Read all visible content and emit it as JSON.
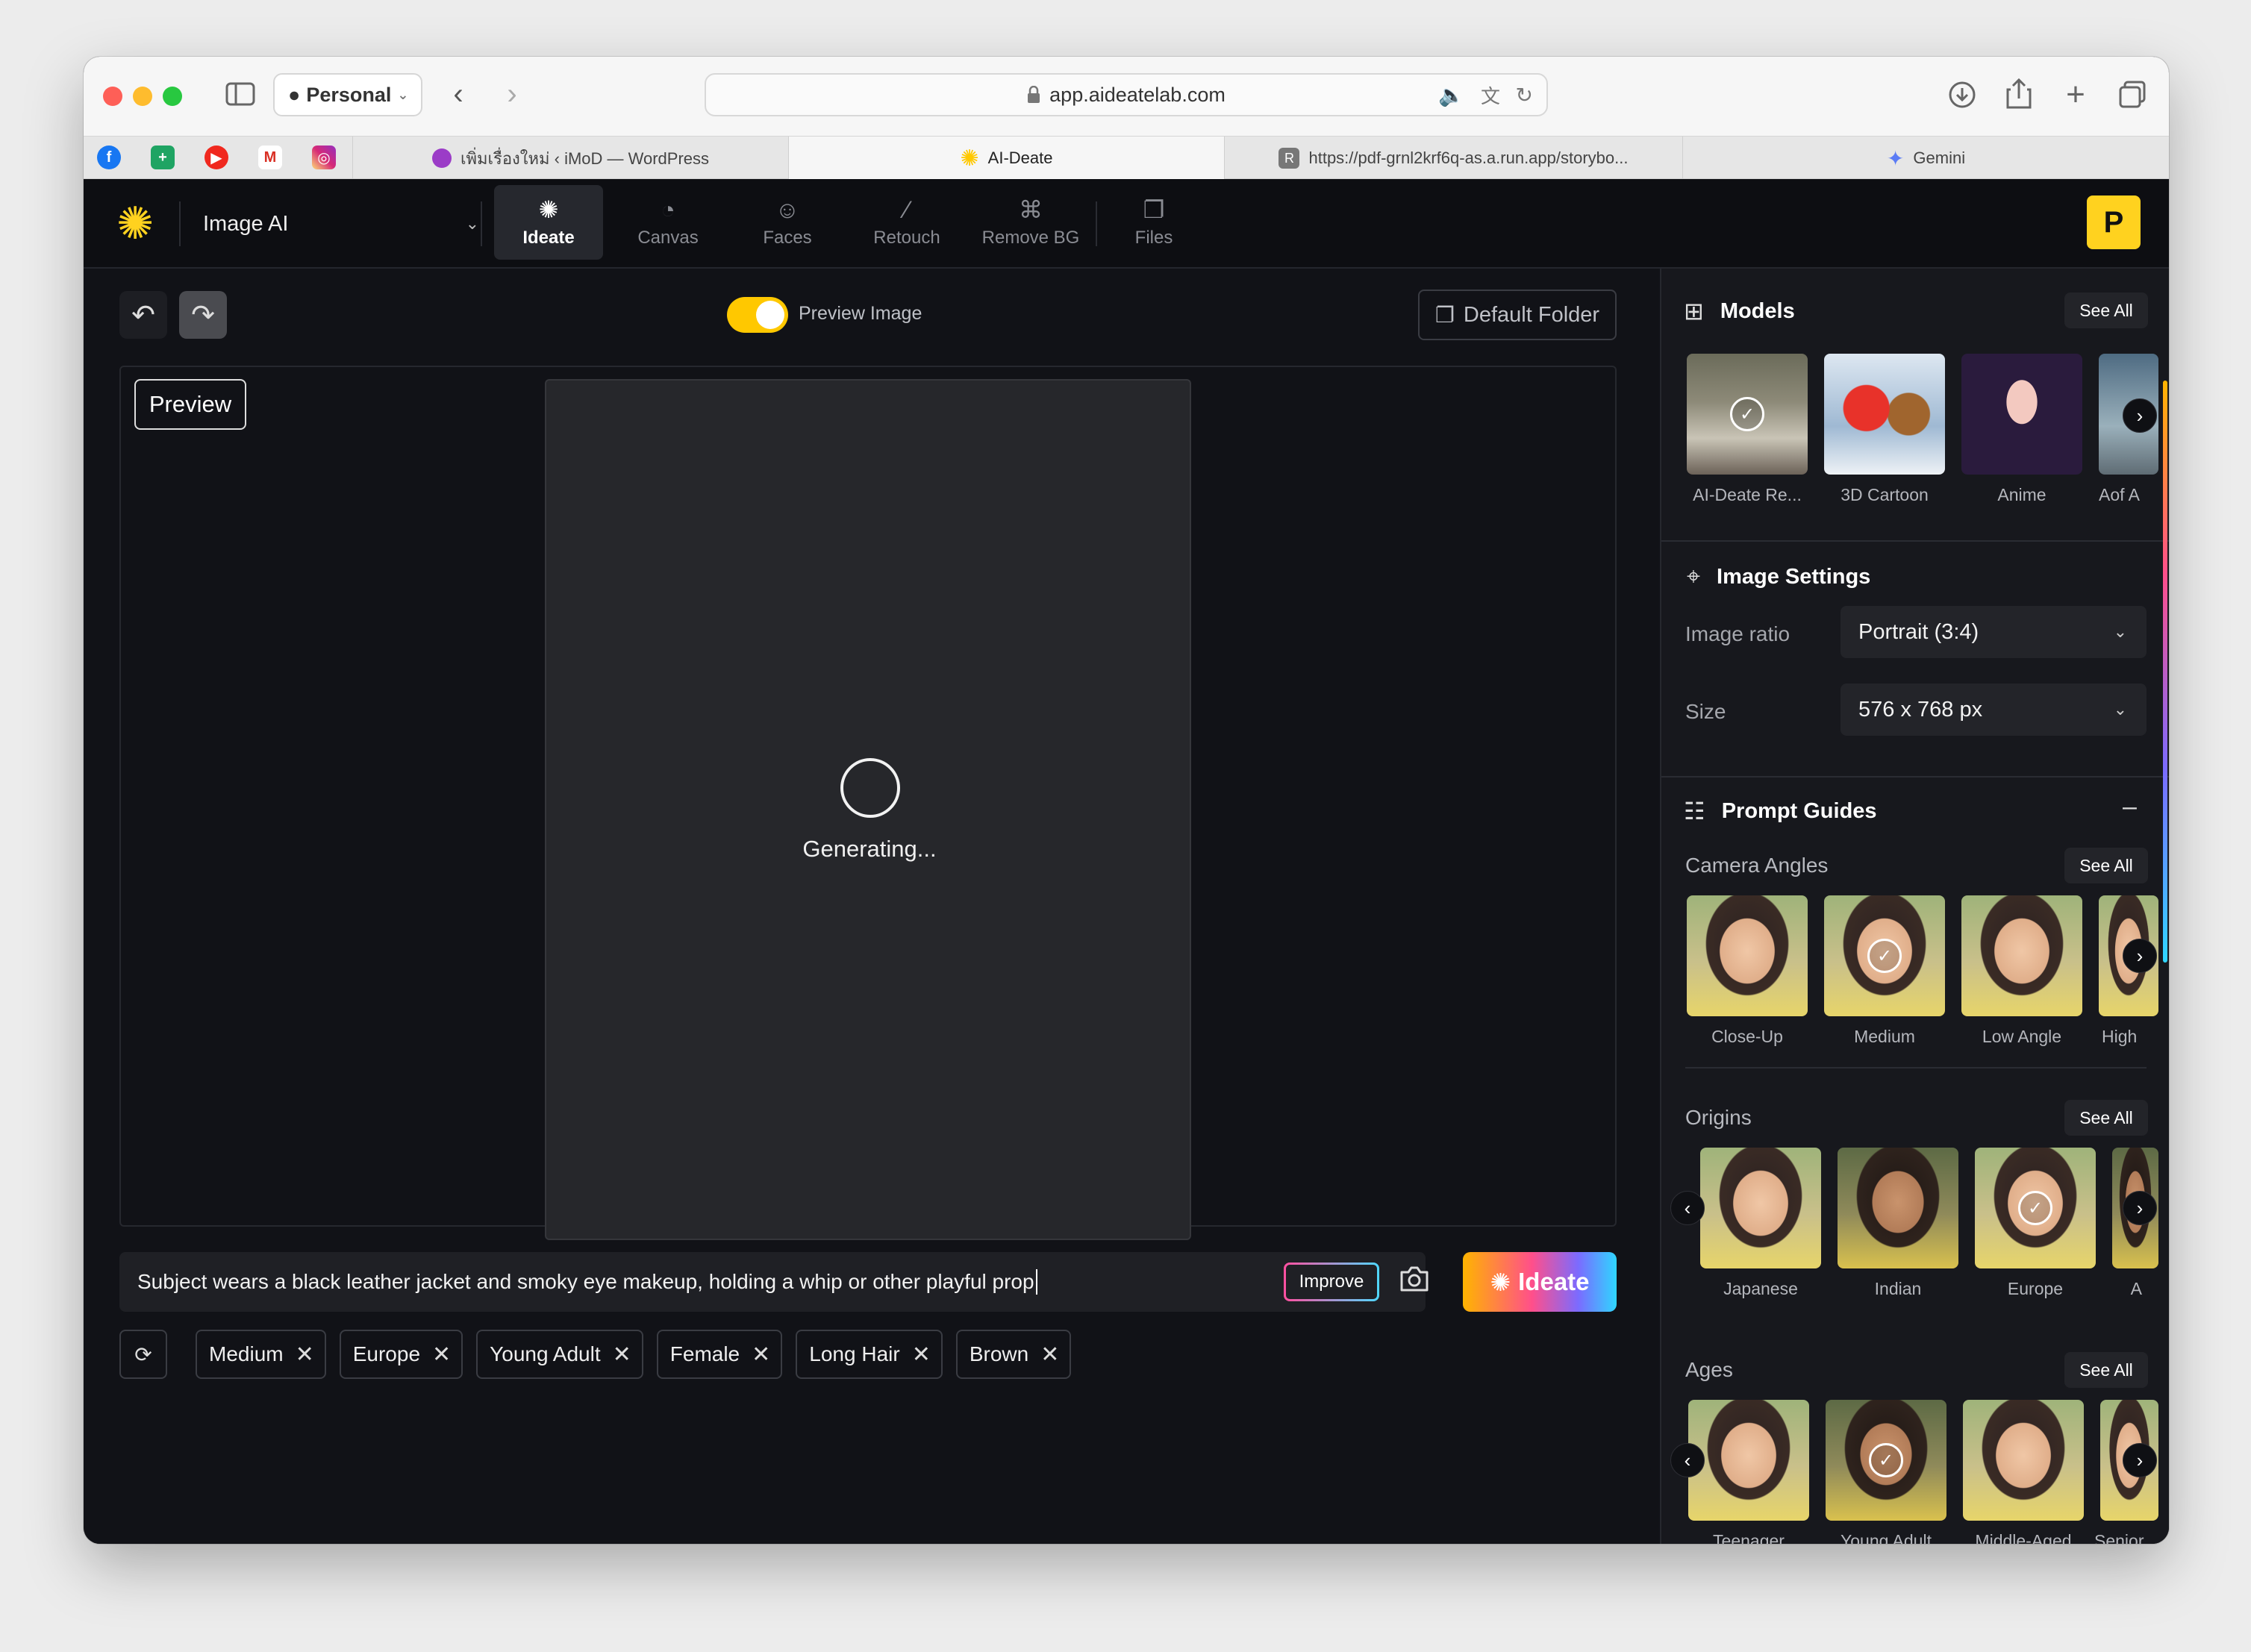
{
  "browser": {
    "profile": "Personal",
    "url": "app.aideatelab.com",
    "tabs": [
      {
        "title": "เพิ่มเรื่องใหม่ ‹ iMoD — WordPress"
      },
      {
        "title": "AI-Deate"
      },
      {
        "title": "https://pdf-grnl2krf6q-as.a.run.app/storybo..."
      },
      {
        "title": "Gemini"
      }
    ]
  },
  "app": {
    "mode": "Image AI",
    "nav": [
      "Ideate",
      "Canvas",
      "Faces",
      "Retouch",
      "Remove BG",
      "Files"
    ],
    "avatar": "P"
  },
  "workspace": {
    "preview_image_label": "Preview Image",
    "default_folder": "Default Folder",
    "preview_tag": "Preview",
    "status": "Generating...",
    "prompt": "Subject wears a black leather jacket and smoky eye makeup, holding a whip or other playful prop",
    "improve": "Improve",
    "ideate": "Ideate",
    "chips": [
      "Medium",
      "Europe",
      "Young Adult",
      "Female",
      "Long Hair",
      "Brown"
    ]
  },
  "panel": {
    "models": {
      "title": "Models",
      "see_all": "See All",
      "items": [
        "AI-Deate Re...",
        "3D Cartoon",
        "Anime",
        "Aof A"
      ]
    },
    "image_settings": {
      "title": "Image Settings",
      "ratio_label": "Image ratio",
      "ratio_value": "Portrait (3:4)",
      "size_label": "Size",
      "size_value": "576 x 768 px"
    },
    "prompt_guides": {
      "title": "Prompt Guides",
      "camera_angles": {
        "title": "Camera Angles",
        "see_all": "See All",
        "items": [
          "Close-Up",
          "Medium",
          "Low Angle",
          "High"
        ]
      },
      "origins": {
        "title": "Origins",
        "see_all": "See All",
        "items": [
          "Japanese",
          "Indian",
          "Europe",
          "A"
        ]
      },
      "ages": {
        "title": "Ages",
        "see_all": "See All",
        "items": [
          "Teenager",
          "Young Adult",
          "Middle-Aged",
          "Senior"
        ]
      }
    }
  },
  "colors": {
    "accent": "#ffd21f",
    "background": "#111217",
    "panel": "#17181d"
  }
}
